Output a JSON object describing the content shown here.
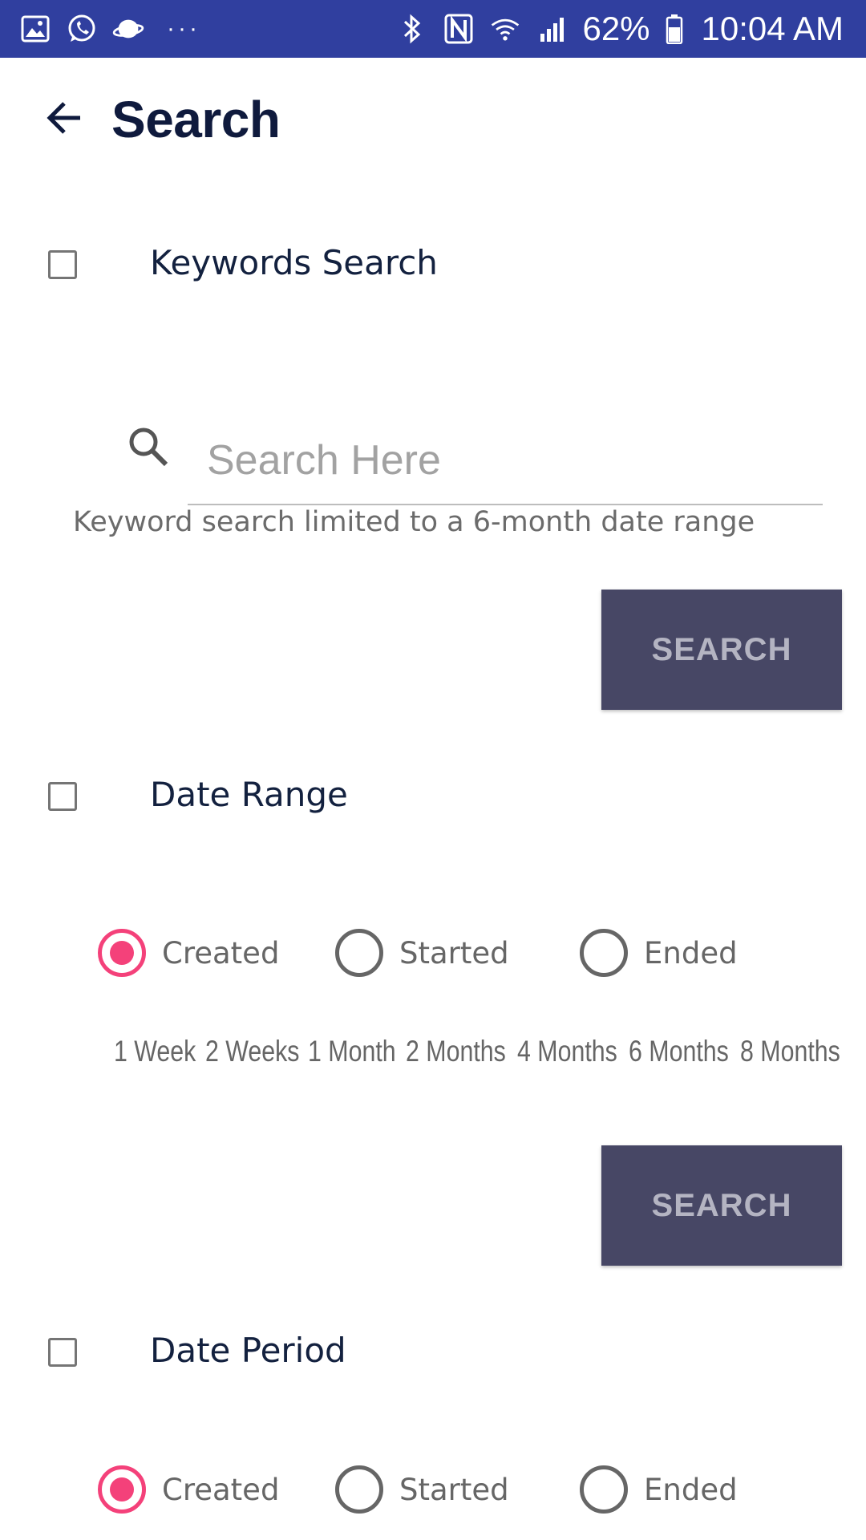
{
  "status_bar": {
    "notification_icons": [
      "gallery-icon",
      "whatsapp-icon",
      "planet-icon"
    ],
    "overflow": "···",
    "system_icons": [
      "bluetooth-icon",
      "nfc-icon",
      "wifi-icon",
      "signal-icon"
    ],
    "battery_pct": "62%",
    "time": "10:04 AM"
  },
  "header": {
    "title": "Search"
  },
  "keywords_section": {
    "label": "Keywords Search",
    "checked": false,
    "search_placeholder": "Search Here",
    "search_value": "",
    "hint": "Keyword search limited to a 6-month date range",
    "button_label": "SEARCH"
  },
  "date_range_section": {
    "label": "Date Range",
    "checked": false,
    "radio_options": [
      {
        "label": "Created",
        "selected": true
      },
      {
        "label": "Started",
        "selected": false
      },
      {
        "label": "Ended",
        "selected": false
      }
    ],
    "durations": [
      "1 Week",
      "2 Weeks",
      "1 Month",
      "2 Months",
      "4 Months",
      "6 Months",
      "8 Months"
    ],
    "button_label": "SEARCH"
  },
  "date_period_section": {
    "label": "Date Period",
    "checked": false,
    "radio_options": [
      {
        "label": "Created",
        "selected": true
      },
      {
        "label": "Started",
        "selected": false
      },
      {
        "label": "Ended",
        "selected": false
      }
    ]
  },
  "colors": {
    "status_bar": "#303f9f",
    "title": "#0f1a3d",
    "button_bg": "#474765",
    "button_text": "#b4b4c2",
    "radio_accent": "#f4417a"
  }
}
